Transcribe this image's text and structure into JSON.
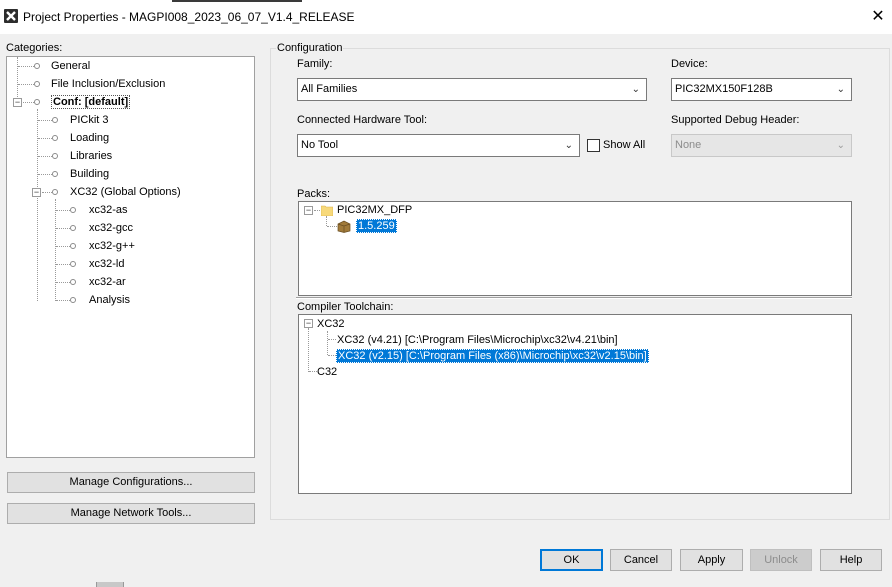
{
  "window": {
    "title": "Project Properties - MAGPI008_2023_06_07_V1.4_RELEASE",
    "close_glyph": "✕"
  },
  "categories": {
    "label": "Categories:",
    "items": [
      {
        "label": "General"
      },
      {
        "label": "File Inclusion/Exclusion"
      },
      {
        "label": "Conf: [default]"
      },
      {
        "label": "PICkit 3"
      },
      {
        "label": "Loading"
      },
      {
        "label": "Libraries"
      },
      {
        "label": "Building"
      },
      {
        "label": "XC32 (Global Options)"
      },
      {
        "label": "xc32-as"
      },
      {
        "label": "xc32-gcc"
      },
      {
        "label": "xc32-g++"
      },
      {
        "label": "xc32-ld"
      },
      {
        "label": "xc32-ar"
      },
      {
        "label": "Analysis"
      }
    ]
  },
  "left_buttons": {
    "manage_configurations": "Manage Configurations...",
    "manage_network_tools": "Manage Network Tools..."
  },
  "configuration": {
    "legend": "Configuration",
    "family_label": "Family:",
    "family_value": "All Families",
    "device_label": "Device:",
    "device_value": "PIC32MX150F128B",
    "hw_tool_label": "Connected Hardware Tool:",
    "hw_tool_value": "No Tool",
    "show_all_label": "Show All",
    "debug_header_label": "Supported Debug Header:",
    "debug_header_value": "None",
    "packs_label": "Packs:",
    "packs": {
      "root": "PIC32MX_DFP",
      "version": "1.5.259"
    },
    "toolchain_label": "Compiler Toolchain:",
    "toolchain": {
      "root": "XC32",
      "items": [
        "XC32 (v4.21) [C:\\Program Files\\Microchip\\xc32\\v4.21\\bin]",
        "XC32 (v2.15) [C:\\Program Files (x86)\\Microchip\\xc32\\v2.15\\bin]"
      ],
      "other": "C32"
    }
  },
  "footer": {
    "ok": "OK",
    "cancel": "Cancel",
    "apply": "Apply",
    "unlock": "Unlock",
    "help": "Help"
  },
  "colors": {
    "selection": "#0078d7",
    "default_button_border": "#0078d7"
  }
}
